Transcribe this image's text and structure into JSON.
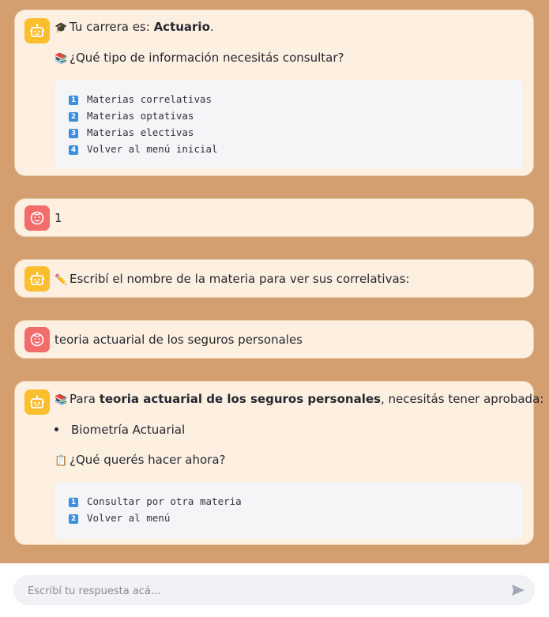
{
  "messages": {
    "m1": {
      "cap_emoji": "🎓",
      "career_prefix": "Tu carrera es: ",
      "career_name": "Actuario",
      "career_suffix": ".",
      "question_emoji": "📚",
      "question": "¿Qué tipo de información necesitás consultar?",
      "options": [
        {
          "num": "1",
          "label": "Materias correlativas"
        },
        {
          "num": "2",
          "label": "Materias optativas"
        },
        {
          "num": "3",
          "label": "Materias electivas"
        },
        {
          "num": "4",
          "label": "Volver al menú inicial"
        }
      ]
    },
    "m2": {
      "text": "1"
    },
    "m3": {
      "emoji": "✏️",
      "text": "Escribí el nombre de la materia para ver sus correlativas:"
    },
    "m4": {
      "text": "teoria actuarial de los seguros personales"
    },
    "m5": {
      "emoji": "📚",
      "prefix": "Para ",
      "subject": "teoria actuarial de los seguros personales",
      "suffix": ", necesitás tener aprobada:",
      "requirements": [
        "Biometría Actuarial"
      ],
      "next_emoji": "📋",
      "next_question": "¿Qué querés hacer ahora?",
      "options": [
        {
          "num": "1",
          "label": "Consultar por otra materia"
        },
        {
          "num": "2",
          "label": "Volver al menú"
        }
      ]
    }
  },
  "input": {
    "placeholder": "Escribí tu respuesta acá..."
  },
  "icons": {
    "bot": "robot-icon",
    "user": "user-face-icon",
    "send": "send-icon"
  },
  "colors": {
    "background": "#d39e70",
    "bot_avatar": "#fbbe2d",
    "user_avatar": "#f26c6c",
    "bubble": "#fdf0e1"
  }
}
